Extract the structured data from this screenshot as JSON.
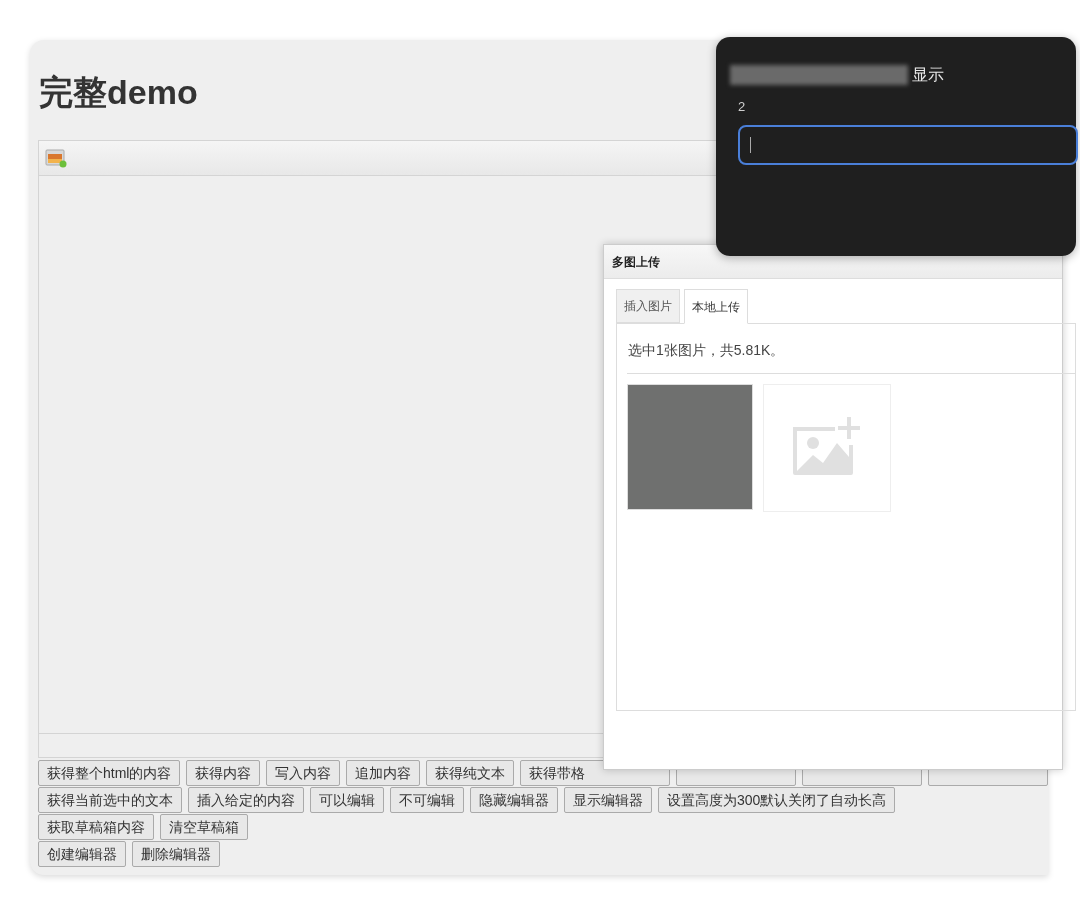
{
  "page": {
    "title": "完整demo"
  },
  "button_rows": [
    [
      {
        "kind": "plain",
        "label": "获得整个html的内容"
      },
      {
        "kind": "plain",
        "label": "获得内容"
      },
      {
        "kind": "plain",
        "label": "写入内容"
      },
      {
        "kind": "plain",
        "label": "追加内容"
      },
      {
        "kind": "plain",
        "label": "获得纯文本"
      },
      {
        "kind": "partial",
        "label": "获得带格"
      },
      {
        "kind": "covered"
      },
      {
        "kind": "covered"
      },
      {
        "kind": "covered"
      }
    ],
    [
      {
        "kind": "plain",
        "label": "获得当前选中的文本"
      },
      {
        "kind": "plain",
        "label": "插入给定的内容"
      },
      {
        "kind": "plain",
        "label": "可以编辑"
      },
      {
        "kind": "plain",
        "label": "不可编辑"
      },
      {
        "kind": "plain",
        "label": "隐藏编辑器"
      },
      {
        "kind": "plain",
        "label": "显示编辑器"
      },
      {
        "kind": "plain",
        "label": "设置高度为300默认关闭了自动长高"
      }
    ],
    [
      {
        "kind": "plain",
        "label": "获取草稿箱内容"
      },
      {
        "kind": "plain",
        "label": "清空草稿箱"
      }
    ],
    [
      {
        "kind": "plain",
        "label": "创建编辑器"
      },
      {
        "kind": "plain",
        "label": "删除编辑器"
      }
    ]
  ],
  "upload_dialog": {
    "title": "多图上传",
    "tabs": [
      {
        "label": "插入图片",
        "selected": false
      },
      {
        "label": "本地上传",
        "selected": true
      }
    ],
    "status": "选中1张图片，共5.81K。",
    "thumbnails": [
      {
        "kind": "image"
      },
      {
        "kind": "add"
      }
    ]
  },
  "prompt": {
    "title": "显示",
    "label": "2",
    "input": {
      "focused": true
    }
  }
}
